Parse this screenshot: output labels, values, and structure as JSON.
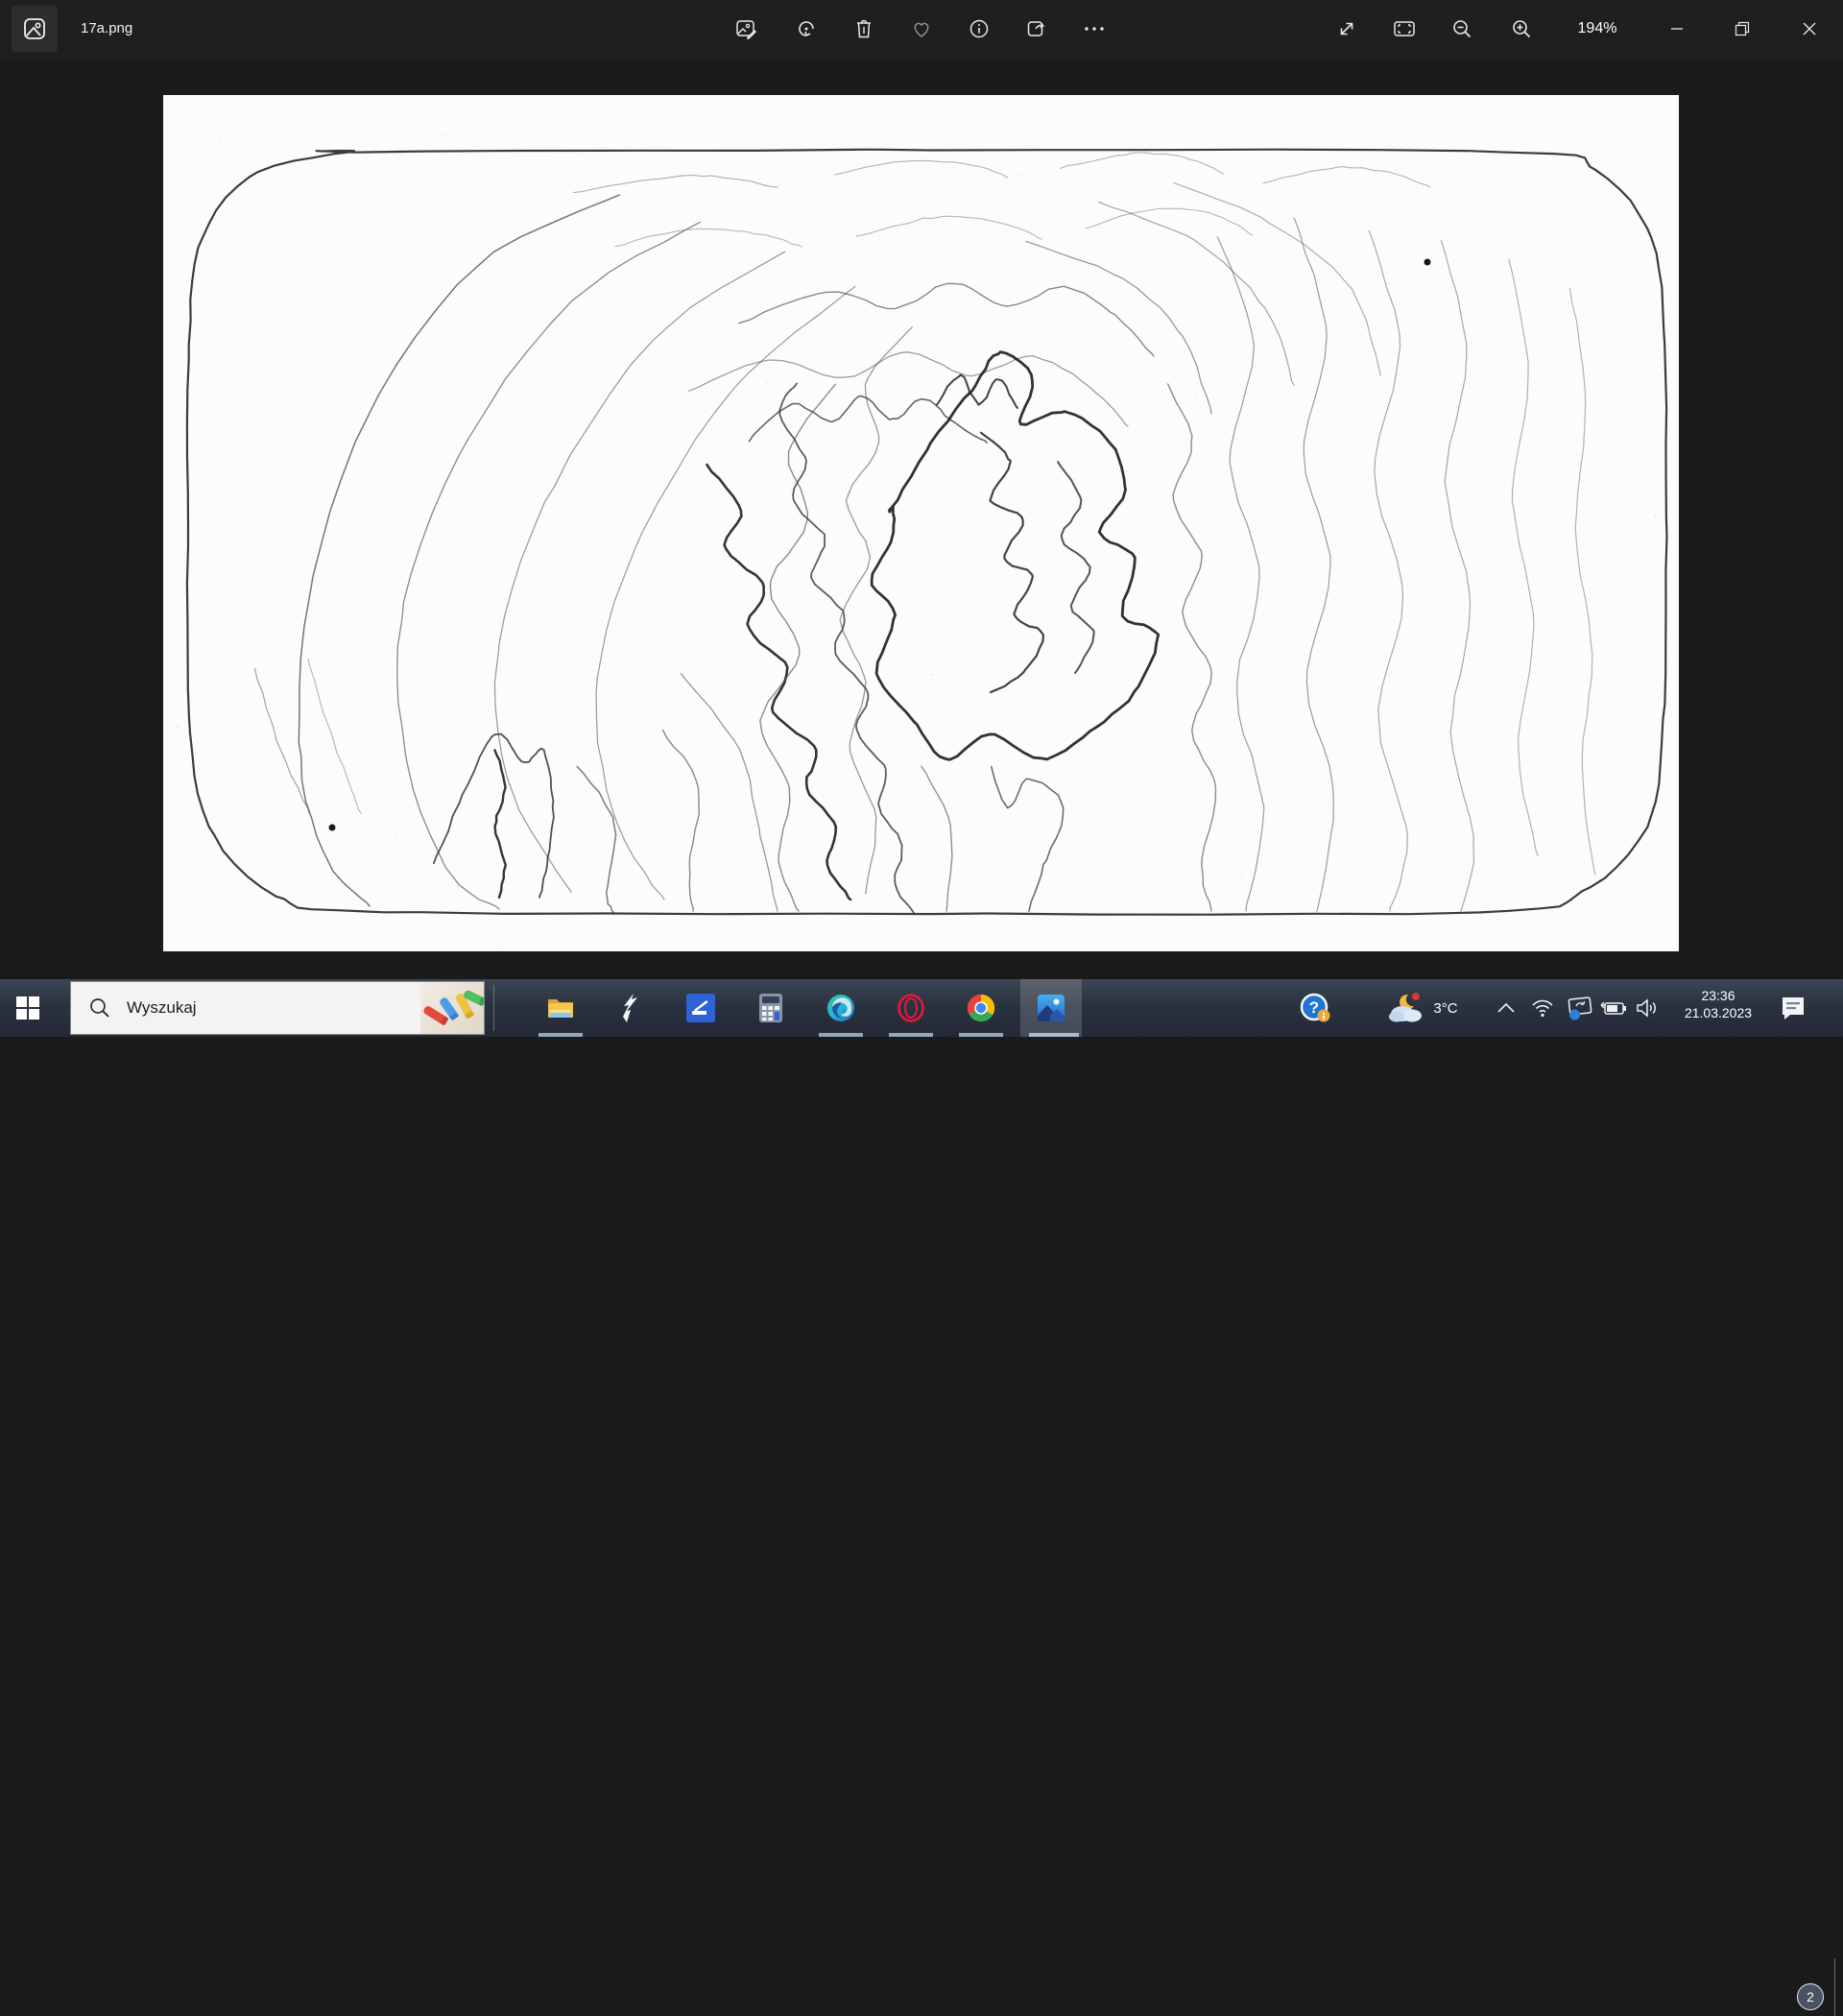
{
  "titlebar": {
    "filename": "17a.png",
    "zoom_level": "194%"
  },
  "toolbar": {
    "buttons": [
      "edit-image",
      "rotate",
      "delete",
      "favorite",
      "info",
      "share",
      "see-more"
    ],
    "view_buttons": [
      "fullscreen",
      "fit-to-window",
      "zoom-out",
      "zoom-in"
    ],
    "window_buttons": [
      "minimize",
      "restore",
      "close"
    ]
  },
  "taskbar": {
    "search_placeholder": "Wyszukaj",
    "temperature": "3°C",
    "time": "23:36",
    "date": "21.03.2023",
    "notification_count": "2",
    "help_glyph": "?",
    "apps": [
      {
        "name": "file-explorer",
        "running": true
      },
      {
        "name": "s-lightning-app",
        "running": false
      },
      {
        "name": "windows-scan",
        "running": false
      },
      {
        "name": "calculator",
        "running": false
      },
      {
        "name": "microsoft-edge",
        "running": true
      },
      {
        "name": "opera-gx",
        "running": true
      },
      {
        "name": "google-chrome",
        "running": true
      },
      {
        "name": "photos",
        "running": true,
        "active": true
      }
    ],
    "tray_icons": [
      "get-help",
      "weather",
      "chevron-up",
      "wifi",
      "cast-sync",
      "battery-charging",
      "speaker",
      "notifications"
    ]
  },
  "colors": {
    "titlebar_bg": "#1f1f1f",
    "viewer_bg": "#1b1b1b",
    "canvas_bg": "#fcfcfc",
    "taskbar_top": "#3d4654",
    "taskbar_bottom": "#232936",
    "running_indicator": "#8fa8bd",
    "searchbox_bg": "#f3f3f3"
  },
  "drawing": {
    "description": "Hand-drawn pencil doodle: rounded-rectangle border filled with concentric wavy contour lines radiating from a dark jagged flame-like cluster right of center; sweeping arcs on the left, vertical wavy lines on the right, two small ink dots (upper right, lower left)."
  }
}
